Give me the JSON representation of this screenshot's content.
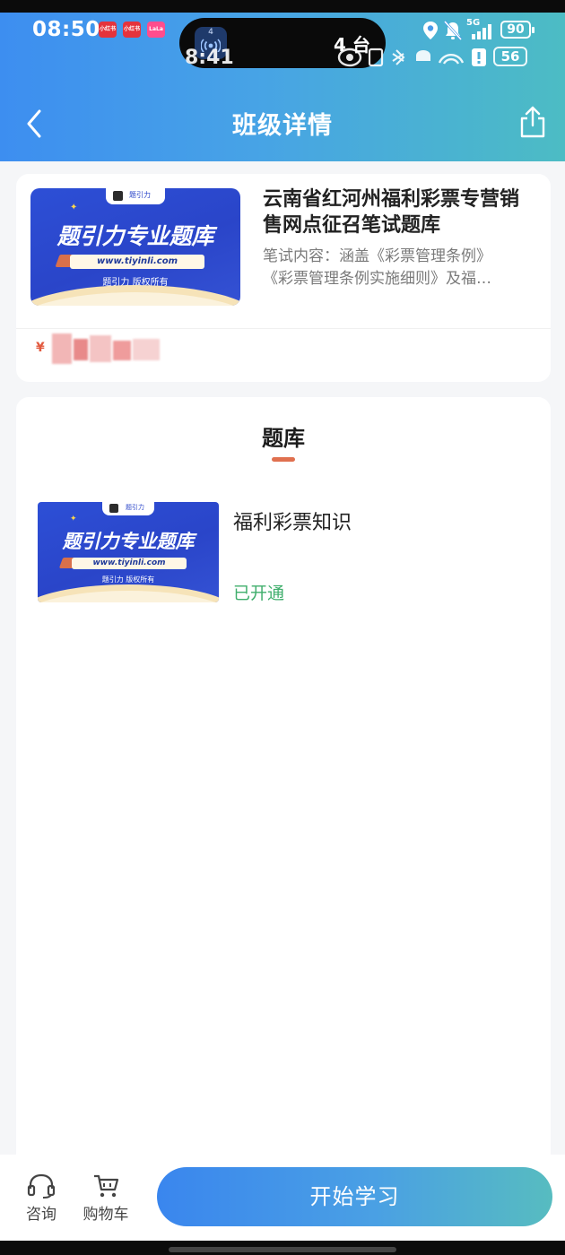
{
  "status_bar": {
    "time": "08:50",
    "apps": [
      "小红书",
      "小红书",
      "LaLa"
    ],
    "island_badge": "4",
    "island_text": "4 台",
    "ghost_time": "8:41",
    "network": "5G",
    "battery": "90",
    "ghost_battery": "56"
  },
  "nav": {
    "title": "班级详情",
    "back_icon": "chevron-left-icon",
    "share_icon": "share-icon"
  },
  "course": {
    "title": "云南省红河州福利彩票专营销售网点征召笔试题库",
    "desc_line1": "笔试内容：涵盖《彩票管理条例》",
    "desc_line2": "《彩票管理条例实施细则》及福…",
    "price_symbol": "¥",
    "thumbnail": {
      "tab_text": "题引力",
      "title": "题引力专业题库",
      "url": "www.tiyinli.com",
      "copyright": "题引力 版权所有"
    }
  },
  "bank": {
    "heading": "题库",
    "items": [
      {
        "name": "福利彩票知识",
        "status": "已开通",
        "thumbnail": {
          "tab_text": "题引力",
          "title": "题引力专业题库",
          "url": "www.tiyinli.com",
          "copyright": "题引力 版权所有"
        }
      }
    ]
  },
  "bottom_bar": {
    "consult_label": "咨询",
    "cart_label": "购物车",
    "start_label": "开始学习"
  },
  "colors": {
    "header_gradient_start": "#3d8ef0",
    "header_gradient_end": "#4cbcc4",
    "status_open": "#3fae6c",
    "tab_underline": "#e0704f",
    "price": "#e25a3f"
  }
}
